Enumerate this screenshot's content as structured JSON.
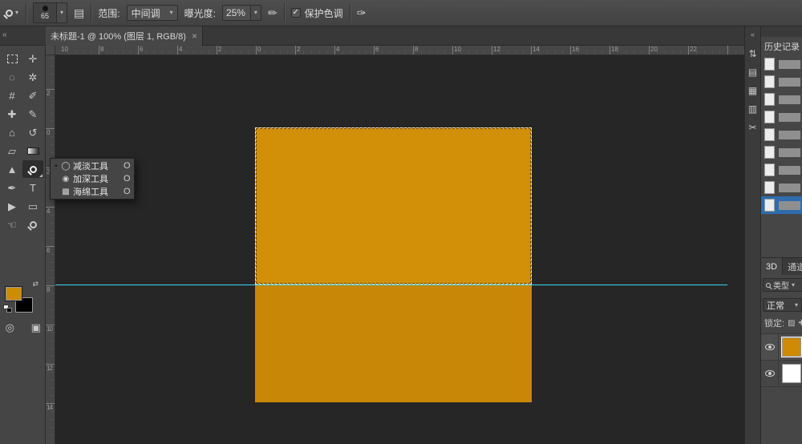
{
  "glyphs": {
    "caret": "▾",
    "collapse_left": "«",
    "collapse_right": "«",
    "close": "×",
    "check": "✓",
    "bullet": "•",
    "swap": "⇄",
    "panel_toggle": "▤",
    "airbrush": "✏",
    "pressure": "✑"
  },
  "options_bar": {
    "brush_size": "65",
    "range_label": "范围:",
    "range_value": "中间调",
    "exposure_label": "曝光度:",
    "exposure_value": "25%",
    "protect_tones": {
      "checked": true,
      "label": "保护色调"
    }
  },
  "tab_bar": {
    "doc_tab": {
      "title": "未标题-1 @ 100% (图层 1, RGB/8) *"
    }
  },
  "toolbar": {
    "foreground_color": "#cf8b04",
    "background_color": "#000000",
    "tools": [
      {
        "name": "rectangular-marquee-tool",
        "shape": "marquee",
        "glyph": ""
      },
      {
        "name": "move-tool",
        "glyph": "✛"
      },
      {
        "name": "lasso-tool",
        "glyph": "◌"
      },
      {
        "name": "magic-wand-tool",
        "glyph": "✲"
      },
      {
        "name": "crop-tool",
        "glyph": "#"
      },
      {
        "name": "eyedropper-tool",
        "glyph": "✐"
      },
      {
        "name": "healing-brush-tool",
        "glyph": "✚"
      },
      {
        "name": "brush-tool",
        "glyph": "✎"
      },
      {
        "name": "clone-stamp-tool",
        "glyph": "⌂"
      },
      {
        "name": "history-brush-tool",
        "glyph": "↺"
      },
      {
        "name": "eraser-tool",
        "glyph": "▱"
      },
      {
        "name": "gradient-tool",
        "shape": "gradient",
        "glyph": ""
      },
      {
        "name": "blur-tool",
        "glyph": "▲"
      },
      {
        "name": "dodge-tool",
        "shape": "dodge",
        "glyph": "",
        "selected": true
      },
      {
        "name": "pen-tool",
        "glyph": "✒"
      },
      {
        "name": "type-tool",
        "glyph": "T"
      },
      {
        "name": "path-selection-tool",
        "glyph": "▶"
      },
      {
        "name": "rectangle-tool",
        "glyph": "▭"
      },
      {
        "name": "hand-tool",
        "glyph": "☜"
      },
      {
        "name": "zoom-tool",
        "shape": "zoom",
        "glyph": ""
      },
      {
        "name": "quick-mask-button",
        "glyph": "◎"
      },
      {
        "name": "screen-mode-button",
        "glyph": "▣"
      }
    ]
  },
  "flyout": {
    "items": [
      {
        "name": "flyout-item-dodge-tool",
        "icon": "dodge-tool-icon",
        "glyph": "◯",
        "label": "减淡工具",
        "shortcut": "O",
        "selected": true
      },
      {
        "name": "flyout-item-burn-tool",
        "icon": "burn-tool-icon",
        "glyph": "◉",
        "label": "加深工具",
        "shortcut": "O",
        "selected": false
      },
      {
        "name": "flyout-item-sponge-tool",
        "icon": "sponge-tool-icon",
        "glyph": "▩",
        "label": "海绵工具",
        "shortcut": "O",
        "selected": false
      }
    ]
  },
  "rulers": {
    "top": [
      "10",
      "8",
      "6",
      "4",
      "2",
      "0",
      "2",
      "4",
      "6",
      "8",
      "10",
      "12",
      "14",
      "16",
      "18",
      "20",
      "22"
    ],
    "left": [
      "2",
      "0",
      "2",
      "4",
      "6",
      "8",
      "10",
      "12",
      "14"
    ]
  },
  "canvas": {
    "square_top_color": "#d19008",
    "square_bottom_color": "#c98708",
    "guide_color": "#38d7ee"
  },
  "right_strip": {
    "icons": [
      {
        "name": "panel-icon-properties",
        "glyph": "⇅"
      },
      {
        "name": "panel-icon-swatches",
        "glyph": "▤"
      },
      {
        "name": "panel-icon-adjustments",
        "glyph": "▦"
      },
      {
        "name": "panel-icon-styles",
        "glyph": "▥"
      },
      {
        "name": "panel-icon-clip",
        "glyph": "✂"
      }
    ]
  },
  "right_panel": {
    "history_title": "历史记录",
    "selection_color": "#2e6cae",
    "history_steps": [
      {
        "selected": false
      },
      {
        "selected": false
      },
      {
        "selected": false
      },
      {
        "selected": false
      },
      {
        "selected": false
      },
      {
        "selected": false
      },
      {
        "selected": false
      },
      {
        "selected": false
      },
      {
        "selected": true
      }
    ],
    "tabs": [
      {
        "name": "tab-3d",
        "label": "3D",
        "active": true
      },
      {
        "name": "tab-channels",
        "label": "通道",
        "active": false
      }
    ],
    "filter_label": "类型",
    "blend_mode": "正常",
    "lock_label": "锁定:",
    "lock_icons": [
      "▨",
      "✚"
    ],
    "layers": [
      {
        "name": "layer-1",
        "thumb_color": "#cf8b04",
        "selected": true
      },
      {
        "name": "layer-background",
        "thumb_color": "#ffffff",
        "selected": false
      }
    ]
  }
}
